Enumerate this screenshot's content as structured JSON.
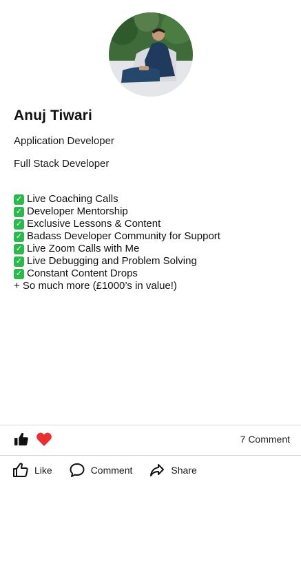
{
  "profile": {
    "name": "Anuj Tiwari",
    "roles": [
      "Application Developer",
      "Full Stack Developer"
    ]
  },
  "features": [
    "Live Coaching Calls",
    "Developer Mentorship",
    "Exclusive Lessons & Content",
    "Badass Developer Community for Support",
    "Live Zoom Calls with Me",
    "Live Debugging and Problem Solving",
    "Constant Content Drops"
  ],
  "features_extra": "+ So much more (£1000’s in value!)",
  "reactions": {
    "icons": [
      "thumbs-up-icon",
      "heart-icon"
    ],
    "heart_color": "#e8302f",
    "comment_count": "7 Comment"
  },
  "actions": {
    "like_label": "Like",
    "comment_label": "Comment",
    "share_label": "Share"
  },
  "colors": {
    "check_green": "#2db84d",
    "divider": "#d6d6d6"
  }
}
